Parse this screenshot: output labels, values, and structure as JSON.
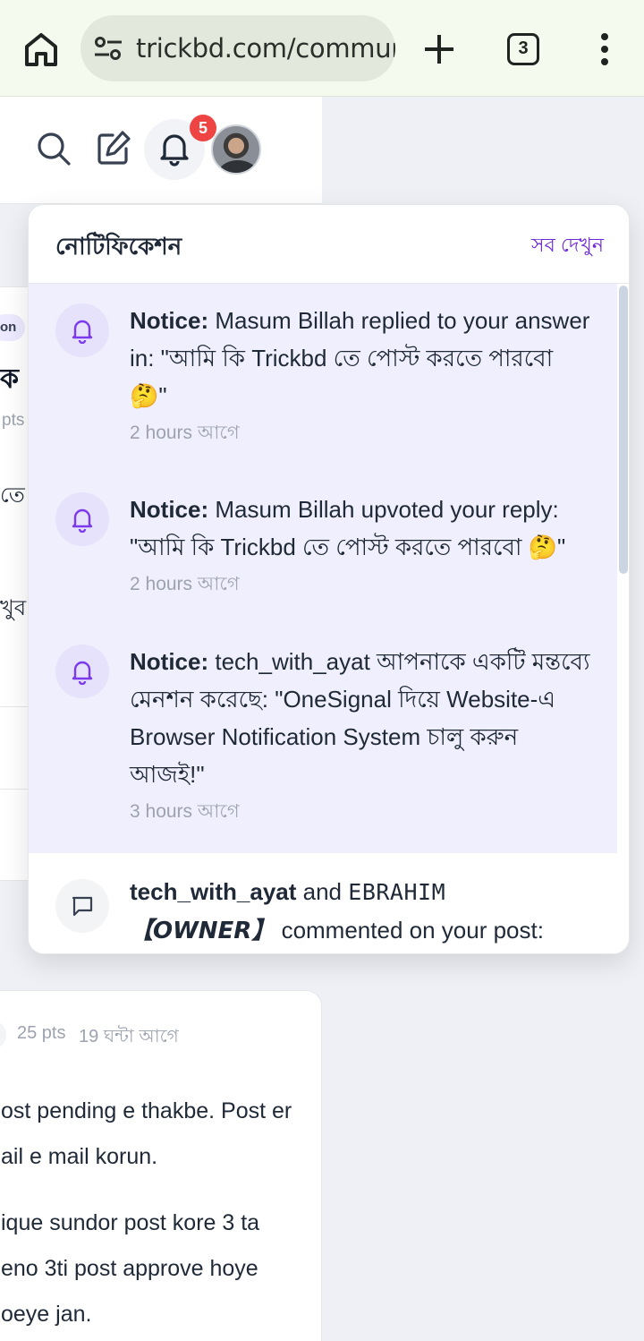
{
  "browser": {
    "url": "trickbd.com/community",
    "tab_count": "3"
  },
  "header": {
    "notification_count": "5"
  },
  "background_card1": {
    "tag": "on",
    "heading_fragment": "ক",
    "pts_fragment": "pts",
    "text1": "তে",
    "text2": "খুব"
  },
  "background_card2": {
    "pts": "25 pts",
    "time": "19 ঘন্টা আগে",
    "lines": [
      "ost pending e thakbe. Post er",
      "ail e mail korun.",
      "ique sundor post kore 3 ta",
      "eno 3ti post approve hoye",
      "oeye jan."
    ]
  },
  "notifications_panel": {
    "title": "নোটিফিকেশন",
    "view_all": "সব দেখুন",
    "items": [
      {
        "icon": "bell-icon",
        "label": "Notice:",
        "text": "Masum Billah replied to your answer in: \"আমি কি Trickbd তে পোস্ট করতে পারবো 🤔\"",
        "time": "2 hours আগে",
        "unread": true
      },
      {
        "icon": "bell-icon",
        "label": "Notice:",
        "text": "Masum Billah upvoted your reply: \"আমি কি Trickbd তে পোস্ট করতে পারবো 🤔\"",
        "time": "2 hours আগে",
        "unread": true
      },
      {
        "icon": "bell-icon",
        "label": "Notice:",
        "text": "tech_with_ayat আপনাকে একটি মন্তব্যে মেনশন করেছে: \"OneSignal দিয়ে Website-এ Browser Notification System চালু করুন আজই!\"",
        "time": "3 hours আগে",
        "unread": true
      },
      {
        "icon": "comment-icon",
        "user1": "tech_with_ayat",
        "and": "and",
        "user2": "𝙴𝙱𝚁𝙰𝙷𝙸𝙼",
        "owner": "【𝙊𝙒𝙉𝙀𝙍】",
        "text": "commented on your post:",
        "unread": false
      }
    ]
  }
}
